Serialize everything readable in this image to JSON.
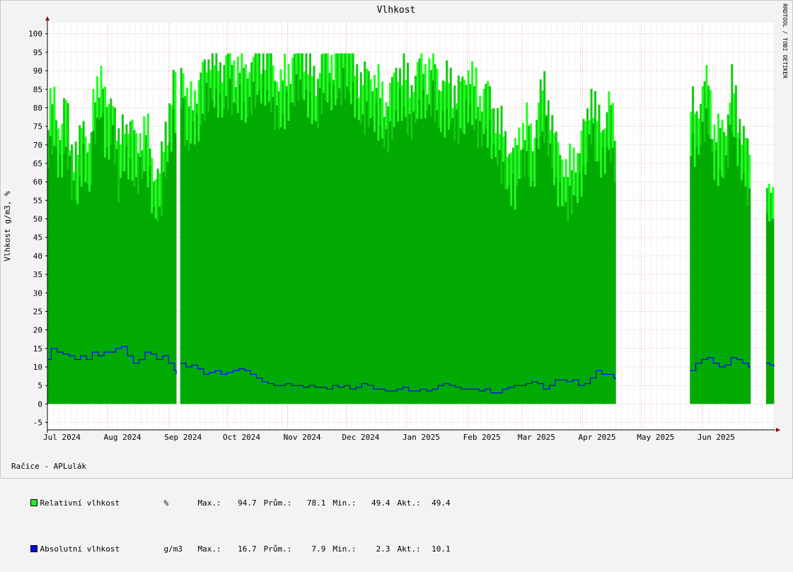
{
  "title": "Vlhkost",
  "watermark": "RRDTOOL / TOBI OETIKER",
  "station": "Račice - APLulák",
  "colors": {
    "background": "#f3f3f3",
    "canvas": "#ffffff",
    "grid_major": "#e08080",
    "grid_minor": "#d9b3b3",
    "relative": "#00aa00",
    "relative_light": "#22ff22",
    "absolute": "#0000ff"
  },
  "legend": [
    {
      "name": "Relativní vlhkost",
      "unit": "%",
      "max_label": "Max.:",
      "max": "94.7",
      "avg_label": "Prům.:",
      "avg": "78.1",
      "min_label": "Min.:",
      "min": "49.4",
      "cur_label": "Akt.:",
      "cur": "49.4",
      "color": "#00cc00"
    },
    {
      "name": "Absolutní vlhkost",
      "unit": "g/m3",
      "max_label": "Max.:",
      "max": "16.7",
      "avg_label": "Prům.:",
      "avg": "7.9",
      "min_label": "Min.:",
      "min": "2.3",
      "cur_label": "Akt.:",
      "cur": "10.1",
      "color": "#0000ff"
    }
  ],
  "chart_data": {
    "type": "area",
    "title": "Vlhkost",
    "ylabel": "Vlhkost g/m3, %",
    "ylim": [
      -7,
      103
    ],
    "yticks": [
      -5,
      0,
      5,
      10,
      15,
      20,
      25,
      30,
      35,
      40,
      45,
      50,
      55,
      60,
      65,
      70,
      75,
      80,
      85,
      90,
      95,
      100
    ],
    "x_unit": "days since 2024-06-25",
    "xlim": [
      0,
      372
    ],
    "xticks": [
      {
        "label": "Jul 2024",
        "day": 6
      },
      {
        "label": "Aug 2024",
        "day": 37
      },
      {
        "label": "Sep 2024",
        "day": 68
      },
      {
        "label": "Oct 2024",
        "day": 98
      },
      {
        "label": "Nov 2024",
        "day": 129
      },
      {
        "label": "Dec 2024",
        "day": 159
      },
      {
        "label": "Jan 2025",
        "day": 190
      },
      {
        "label": "Feb 2025",
        "day": 221
      },
      {
        "label": "Mar 2025",
        "day": 249
      },
      {
        "label": "Apr 2025",
        "day": 280
      },
      {
        "label": "May 2025",
        "day": 310
      },
      {
        "label": "Jun 2025",
        "day": 341
      }
    ],
    "grid": true,
    "legend_position": "bottom-left",
    "gaps": [
      [
        66,
        68
      ],
      [
        291,
        329
      ],
      [
        360,
        368
      ]
    ],
    "series": [
      {
        "name": "Relativní vlhkost",
        "type": "area",
        "points": [
          [
            0,
            74
          ],
          [
            3,
            77
          ],
          [
            6,
            68
          ],
          [
            9,
            76
          ],
          [
            12,
            65
          ],
          [
            15,
            62
          ],
          [
            18,
            72
          ],
          [
            21,
            63
          ],
          [
            24,
            80
          ],
          [
            27,
            86
          ],
          [
            30,
            72
          ],
          [
            33,
            80
          ],
          [
            36,
            64
          ],
          [
            39,
            72
          ],
          [
            42,
            70
          ],
          [
            45,
            65
          ],
          [
            48,
            70
          ],
          [
            51,
            68
          ],
          [
            54,
            58
          ],
          [
            57,
            56
          ],
          [
            60,
            70
          ],
          [
            63,
            78
          ],
          [
            66,
            85
          ],
          [
            68,
            89
          ],
          [
            71,
            75
          ],
          [
            74,
            80
          ],
          [
            77,
            80
          ],
          [
            80,
            86
          ],
          [
            83,
            90
          ],
          [
            86,
            88
          ],
          [
            89,
            86
          ],
          [
            92,
            89
          ],
          [
            95,
            87
          ],
          [
            98,
            88
          ],
          [
            101,
            84
          ],
          [
            104,
            88
          ],
          [
            107,
            90
          ],
          [
            110,
            91
          ],
          [
            113,
            89
          ],
          [
            116,
            84
          ],
          [
            119,
            82
          ],
          [
            122,
            85
          ],
          [
            125,
            88
          ],
          [
            128,
            92
          ],
          [
            131,
            90
          ],
          [
            134,
            86
          ],
          [
            137,
            82
          ],
          [
            140,
            88
          ],
          [
            143,
            90
          ],
          [
            146,
            89
          ],
          [
            149,
            90
          ],
          [
            152,
            92
          ],
          [
            155,
            90
          ],
          [
            158,
            86
          ],
          [
            161,
            82
          ],
          [
            164,
            84
          ],
          [
            167,
            83
          ],
          [
            170,
            80
          ],
          [
            173,
            77
          ],
          [
            176,
            80
          ],
          [
            179,
            86
          ],
          [
            182,
            86
          ],
          [
            185,
            80
          ],
          [
            188,
            84
          ],
          [
            191,
            87
          ],
          [
            194,
            86
          ],
          [
            197,
            88
          ],
          [
            200,
            82
          ],
          [
            203,
            82
          ],
          [
            206,
            83
          ],
          [
            209,
            80
          ],
          [
            212,
            80
          ],
          [
            215,
            86
          ],
          [
            218,
            82
          ],
          [
            221,
            78
          ],
          [
            224,
            80
          ],
          [
            227,
            76
          ],
          [
            230,
            73
          ],
          [
            233,
            68
          ],
          [
            236,
            64
          ],
          [
            239,
            62
          ],
          [
            242,
            70
          ],
          [
            245,
            72
          ],
          [
            248,
            64
          ],
          [
            251,
            78
          ],
          [
            254,
            80
          ],
          [
            257,
            75
          ],
          [
            260,
            64
          ],
          [
            263,
            62
          ],
          [
            266,
            58
          ],
          [
            269,
            62
          ],
          [
            272,
            64
          ],
          [
            275,
            70
          ],
          [
            278,
            80
          ],
          [
            281,
            72
          ],
          [
            284,
            70
          ],
          [
            287,
            76
          ],
          [
            290,
            70
          ],
          [
            291,
            69
          ],
          [
            329,
            76
          ],
          [
            332,
            73
          ],
          [
            335,
            80
          ],
          [
            338,
            82
          ],
          [
            341,
            70
          ],
          [
            344,
            68
          ],
          [
            347,
            70
          ],
          [
            350,
            82
          ],
          [
            353,
            74
          ],
          [
            356,
            68
          ],
          [
            359,
            60
          ],
          [
            360,
            60
          ],
          [
            368,
            58
          ],
          [
            370,
            52
          ],
          [
            372,
            49.4
          ]
        ]
      },
      {
        "name": "Absolutní vlhkost",
        "type": "line",
        "points": [
          [
            0,
            12
          ],
          [
            2,
            15
          ],
          [
            5,
            14
          ],
          [
            8,
            13.5
          ],
          [
            11,
            13
          ],
          [
            14,
            12
          ],
          [
            17,
            13
          ],
          [
            20,
            12
          ],
          [
            23,
            14
          ],
          [
            26,
            13
          ],
          [
            29,
            14
          ],
          [
            32,
            14
          ],
          [
            35,
            15
          ],
          [
            38,
            15.5
          ],
          [
            41,
            13
          ],
          [
            44,
            11
          ],
          [
            47,
            12
          ],
          [
            50,
            14
          ],
          [
            53,
            13.5
          ],
          [
            56,
            12
          ],
          [
            59,
            13
          ],
          [
            62,
            11
          ],
          [
            65,
            9
          ],
          [
            66,
            8
          ],
          [
            68,
            11
          ],
          [
            71,
            10
          ],
          [
            74,
            10.5
          ],
          [
            77,
            9.5
          ],
          [
            80,
            8
          ],
          [
            83,
            8.5
          ],
          [
            86,
            9
          ],
          [
            89,
            8
          ],
          [
            92,
            8.5
          ],
          [
            95,
            9
          ],
          [
            98,
            9.5
          ],
          [
            101,
            9
          ],
          [
            104,
            8
          ],
          [
            107,
            7
          ],
          [
            110,
            6
          ],
          [
            113,
            5.5
          ],
          [
            116,
            5
          ],
          [
            119,
            5
          ],
          [
            122,
            5.5
          ],
          [
            125,
            5
          ],
          [
            128,
            5
          ],
          [
            131,
            4.5
          ],
          [
            134,
            5
          ],
          [
            137,
            4.5
          ],
          [
            140,
            4.5
          ],
          [
            143,
            4
          ],
          [
            146,
            5
          ],
          [
            149,
            4.5
          ],
          [
            152,
            5
          ],
          [
            155,
            4
          ],
          [
            158,
            4.5
          ],
          [
            161,
            5.5
          ],
          [
            164,
            5
          ],
          [
            167,
            4
          ],
          [
            170,
            4
          ],
          [
            173,
            3.5
          ],
          [
            176,
            3.5
          ],
          [
            179,
            4
          ],
          [
            182,
            4.5
          ],
          [
            185,
            3.5
          ],
          [
            188,
            3.5
          ],
          [
            191,
            4
          ],
          [
            194,
            3.5
          ],
          [
            197,
            4
          ],
          [
            200,
            5
          ],
          [
            203,
            5.5
          ],
          [
            206,
            5
          ],
          [
            209,
            4.5
          ],
          [
            212,
            4
          ],
          [
            215,
            4
          ],
          [
            218,
            4
          ],
          [
            221,
            3.5
          ],
          [
            224,
            4
          ],
          [
            227,
            3
          ],
          [
            230,
            3
          ],
          [
            233,
            4
          ],
          [
            236,
            4.5
          ],
          [
            239,
            5
          ],
          [
            242,
            5
          ],
          [
            245,
            5.5
          ],
          [
            248,
            6
          ],
          [
            251,
            5.5
          ],
          [
            254,
            4
          ],
          [
            257,
            5
          ],
          [
            260,
            6.5
          ],
          [
            263,
            6.5
          ],
          [
            266,
            6
          ],
          [
            269,
            6.5
          ],
          [
            272,
            5
          ],
          [
            275,
            5.5
          ],
          [
            278,
            7
          ],
          [
            281,
            9
          ],
          [
            284,
            8
          ],
          [
            287,
            8
          ],
          [
            290,
            7
          ],
          [
            291,
            6.8
          ],
          [
            329,
            9
          ],
          [
            332,
            11
          ],
          [
            335,
            12
          ],
          [
            338,
            12.5
          ],
          [
            341,
            11
          ],
          [
            344,
            10
          ],
          [
            347,
            10.5
          ],
          [
            350,
            12.5
          ],
          [
            353,
            12
          ],
          [
            356,
            11
          ],
          [
            359,
            10
          ],
          [
            360,
            10
          ],
          [
            368,
            11
          ],
          [
            370,
            10.5
          ],
          [
            372,
            10.1
          ]
        ]
      }
    ]
  }
}
